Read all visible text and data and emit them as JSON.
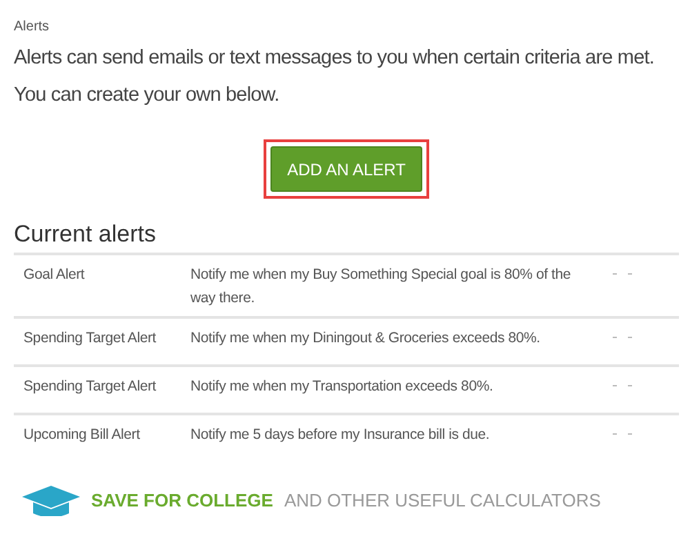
{
  "breadcrumb": "Alerts",
  "intro": [
    "Alerts can send emails or text messages to you when certain criteria are met.",
    "You can create your own below."
  ],
  "add_button": {
    "label": "ADD AN ALERT",
    "highlighted": true
  },
  "current_alerts": {
    "title": "Current alerts",
    "rows": [
      {
        "type": "Goal Alert",
        "description": "Notify me when my Buy Something Special goal is 80% of the way there."
      },
      {
        "type": "Spending Target Alert",
        "description": "Notify me when my Diningout & Groceries exceeds 80%."
      },
      {
        "type": "Spending Target Alert",
        "description": "Notify me when my Transportation exceeds 80%."
      },
      {
        "type": "Upcoming Bill Alert",
        "description": "Notify me 5 days before my Insurance bill is due."
      }
    ]
  },
  "banner": {
    "highlight": "SAVE FOR COLLEGE",
    "text": "AND OTHER USEFUL CALCULATORS"
  }
}
